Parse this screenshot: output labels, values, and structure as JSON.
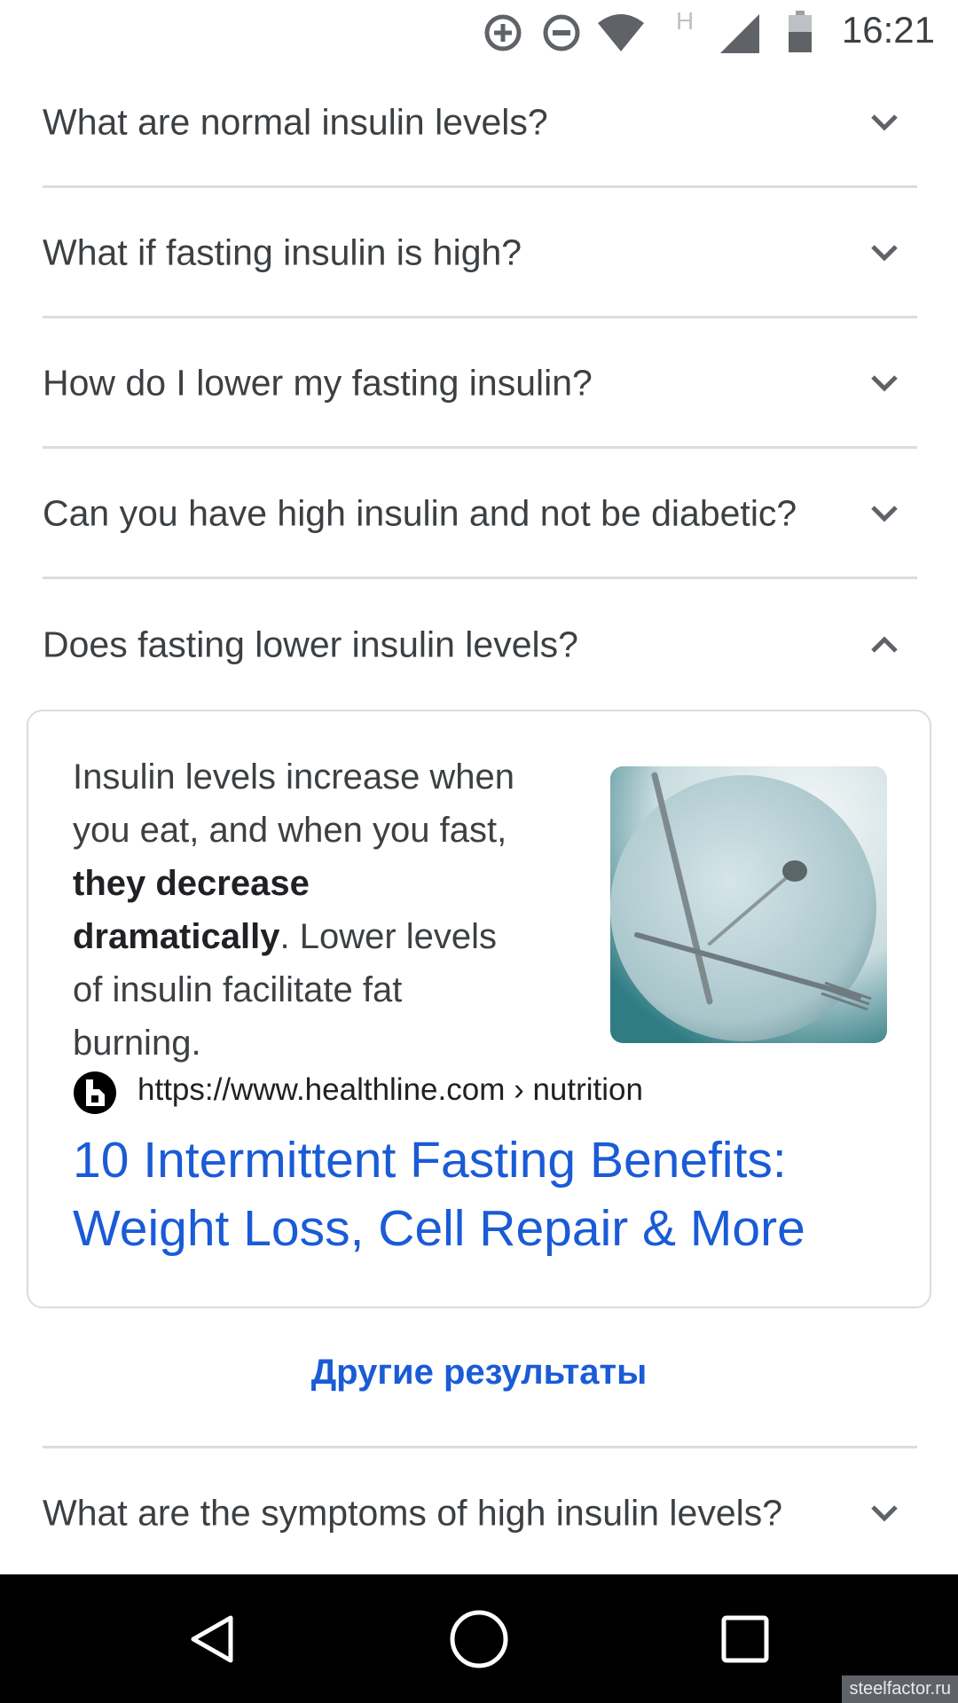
{
  "status_bar": {
    "time": "16:21",
    "network_badge": "H",
    "icons": [
      "data-saver-icon",
      "do-not-disturb-icon",
      "wifi-icon",
      "cell-signal-icon",
      "battery-icon"
    ]
  },
  "faq": {
    "questions": [
      "What are normal insulin levels?",
      "What if fasting insulin is high?",
      "How do I lower my fasting insulin?",
      "Can you have high insulin and not be diabetic?",
      "Does fasting lower insulin levels?"
    ],
    "expanded_index": 4,
    "last_question": "What are the symptoms of high insulin levels?"
  },
  "answer": {
    "text_before": "Insulin levels increase when you eat, and when you fast, ",
    "text_bold": "they decrease dramatically",
    "text_after": ". Lower levels of insulin facilitate fat burning.",
    "image_icon": "plate-with-cutlery-image",
    "source_url": "https://www.healthline.com › nutrition",
    "result_title": "10 Intermittent Fasting Benefits: Weight Loss, Cell Repair & More"
  },
  "more_results_label": "Другие результаты",
  "watermark": "steelfactor.ru",
  "colors": {
    "link": "#1a5bd6",
    "divider": "#dadce0",
    "text": "#3c4043"
  }
}
